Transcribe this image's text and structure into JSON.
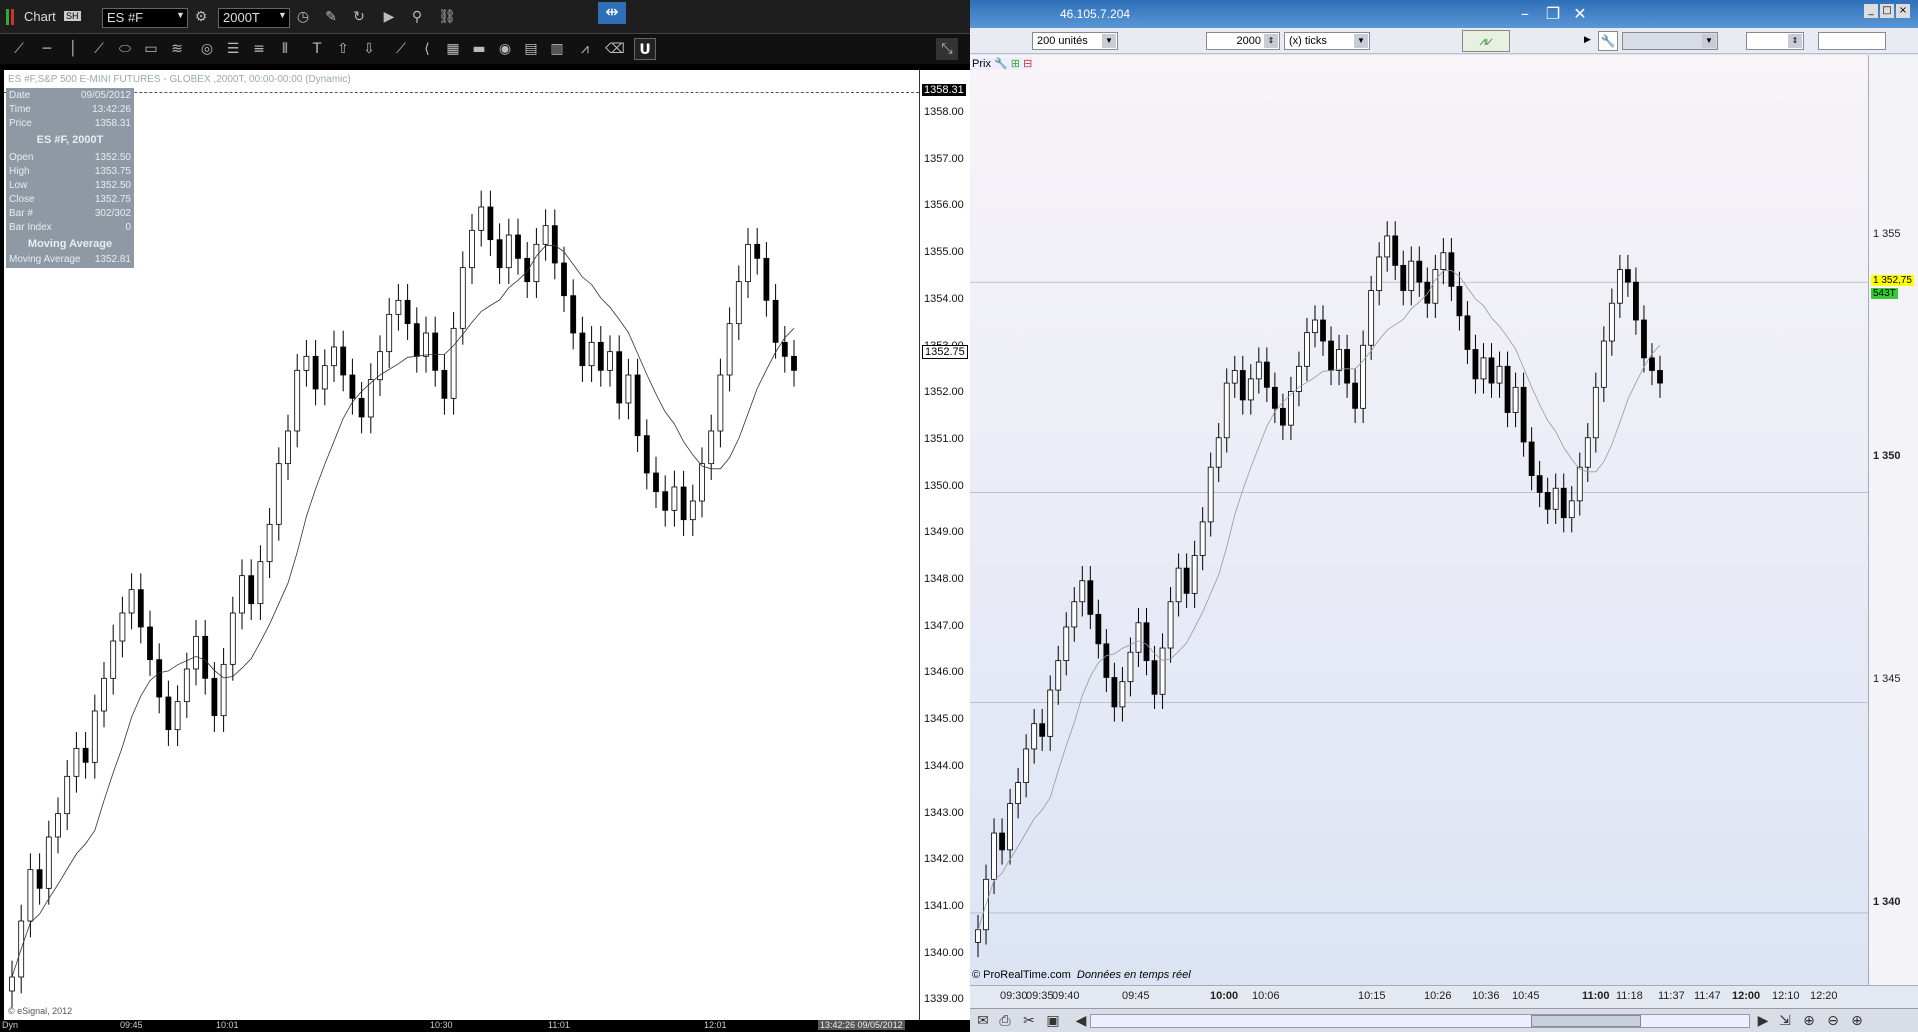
{
  "esignal": {
    "title": "Chart",
    "title_badge": "SH",
    "symbol": "ES #F",
    "interval": "2000T",
    "chart_header": "ES #F,S&P 500 E-MINI FUTURES - GLOBEX ,2000T, 00:00-00:00 (Dynamic)",
    "copyright": "© eSignal, 2012",
    "bottom_tab": "Dyn",
    "bottom_timestamp": "13:42:26 09/05/2012",
    "price_marker_top": "1358.31",
    "price_marker_last": "1352.75",
    "x_ticks": [
      "09:45",
      "10:01",
      "10:30",
      "11:01",
      "12:01"
    ],
    "y_ticks": [
      "1358.00",
      "1357.00",
      "1356.00",
      "1355.00",
      "1354.00",
      "1353.00",
      "1352.00",
      "1351.00",
      "1350.00",
      "1349.00",
      "1348.00",
      "1347.00",
      "1346.00",
      "1345.00",
      "1344.00",
      "1343.00",
      "1342.00",
      "1341.00",
      "1340.00",
      "1339.00"
    ],
    "info": {
      "date_label": "Date",
      "date": "09/05/2012",
      "time_label": "Time",
      "time": "13:42:26",
      "price_label": "Price",
      "price": "1358.31",
      "section": "ES #F, 2000T",
      "open_label": "Open",
      "open": "1352.50",
      "high_label": "High",
      "high": "1353.75",
      "low_label": "Low",
      "low": "1352.50",
      "close_label": "Close",
      "close": "1352.75",
      "barnum_label": "Bar #",
      "barnum": "302/302",
      "barindex_label": "Bar Index",
      "barindex": "0",
      "ma_section": "Moving Average",
      "ma_label": "Moving Average",
      "ma": "1352.81"
    }
  },
  "prorealtime": {
    "window_title": "46.105.7.204",
    "units": "200 unités",
    "ticks_value": "2000",
    "ticks_unit": "(x) ticks",
    "prix_label": "Prix",
    "footer": "© ProRealTime.com",
    "footer_realtime": "Données en temps réel",
    "last_price": "1 352,75",
    "tick_count": "543T",
    "y_ticks": [
      "1 355",
      "1 350",
      "1 345",
      "1 340"
    ],
    "x_ticks": [
      "09:30",
      "09:35",
      "09:40",
      "09:45",
      "10:00",
      "10:06",
      "10:15",
      "10:26",
      "10:36",
      "10:45",
      "11:00",
      "11:18",
      "11:37",
      "11:47",
      "12:00",
      "12:10",
      "12:20"
    ]
  },
  "chart_data": {
    "type": "candlestick",
    "title": "ES #F,S&P 500 E-MINI FUTURES - GLOBEX ,2000T, 00:00-00:00 (Dynamic)",
    "ylim": [
      1339,
      1358.5
    ],
    "series_name": "Moving Average",
    "closes": [
      1339.6,
      1340.8,
      1341.9,
      1341.5,
      1342.6,
      1343.1,
      1343.9,
      1344.5,
      1344.2,
      1345.3,
      1346.0,
      1346.8,
      1347.4,
      1347.9,
      1347.1,
      1346.4,
      1345.6,
      1344.9,
      1345.5,
      1346.2,
      1346.9,
      1346.0,
      1345.2,
      1346.3,
      1347.4,
      1348.2,
      1347.6,
      1348.5,
      1349.3,
      1350.6,
      1351.3,
      1352.6,
      1352.9,
      1352.2,
      1352.7,
      1353.1,
      1352.5,
      1352.0,
      1351.6,
      1352.4,
      1353.0,
      1353.8,
      1354.1,
      1353.6,
      1352.9,
      1353.4,
      1352.6,
      1352.0,
      1353.5,
      1354.8,
      1355.6,
      1356.1,
      1355.4,
      1354.8,
      1355.5,
      1355.0,
      1354.5,
      1355.3,
      1355.7,
      1354.9,
      1354.2,
      1353.4,
      1352.7,
      1353.2,
      1352.6,
      1353.0,
      1351.9,
      1352.5,
      1351.2,
      1350.4,
      1350.0,
      1349.6,
      1350.1,
      1349.4,
      1349.8,
      1350.6,
      1351.3,
      1352.5,
      1353.6,
      1354.5,
      1355.3,
      1355.0,
      1354.1,
      1353.2,
      1352.9,
      1352.6
    ]
  }
}
